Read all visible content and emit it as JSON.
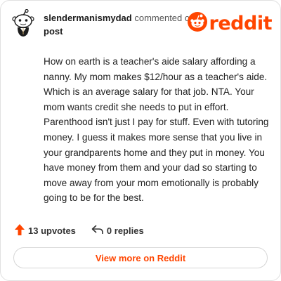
{
  "comment": {
    "username": "slendermanismydad",
    "action_text": "commented on",
    "target_link": "post",
    "body": "How on earth is a teacher's aide salary affording a nanny. My mom makes $12/hour as a teacher's aide. Which is an average salary for that job. NTA. Your mom wants credit she needs to put in effort. Parenthood isn't just I pay for stuff. Even with tutoring money. I guess it makes more sense that you live in your grandparents home and they put in money. You have money from them and your dad so starting to move away from your mom emotionally is probably going to be for the best."
  },
  "brand": {
    "wordmark": "reddit",
    "color": "#ff4500"
  },
  "actions": {
    "upvotes": "13 upvotes",
    "replies": "0 replies"
  },
  "footer": {
    "view_more_label": "View more on Reddit"
  },
  "icons": {
    "avatar": "snoo-avatar-icon",
    "upvote": "upvote-arrow-icon",
    "reply": "reply-arrow-icon",
    "logo": "reddit-logo-icon"
  }
}
